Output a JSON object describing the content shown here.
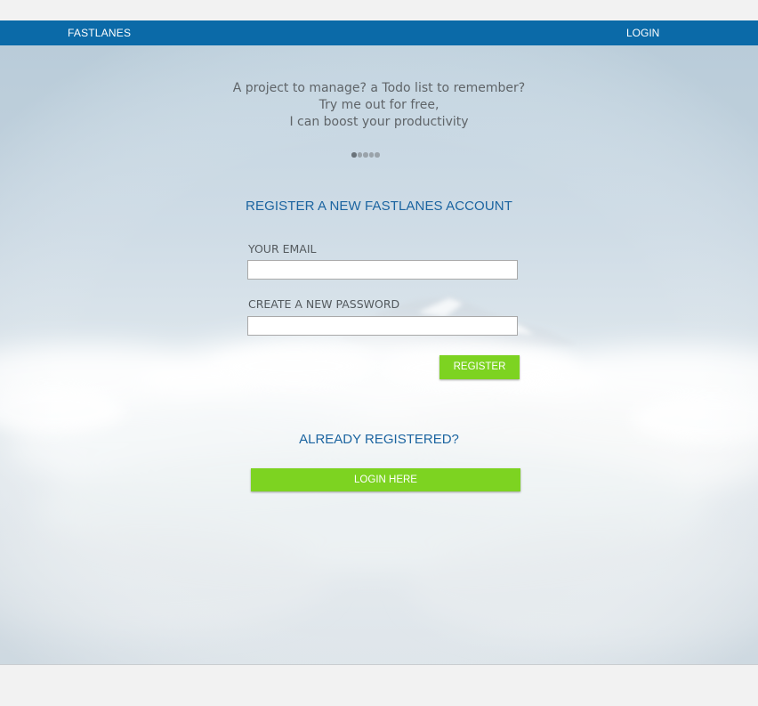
{
  "nav": {
    "brand": "FASTLANES",
    "login": "LOGIN"
  },
  "hero": {
    "tagline": [
      "A project to manage? a Todo list to remember?",
      "Try me out for free,",
      "I can boost your productivity"
    ],
    "carousel": {
      "total": 5,
      "active": 1
    }
  },
  "register": {
    "heading": "REGISTER A NEW FASTLANES ACCOUNT",
    "email_label": "YOUR EMAIL",
    "email_value": "",
    "password_label": "CREATE A NEW PASSWORD",
    "password_value": "",
    "submit_label": "REGISTER"
  },
  "already": {
    "heading": "ALREADY REGISTERED?",
    "login_label": "LOGIN HERE"
  },
  "colors": {
    "nav_bg": "#0b6aa8",
    "heading": "#1b64a0",
    "button": "#7dd321",
    "page_bg": "#f2f2f2"
  }
}
